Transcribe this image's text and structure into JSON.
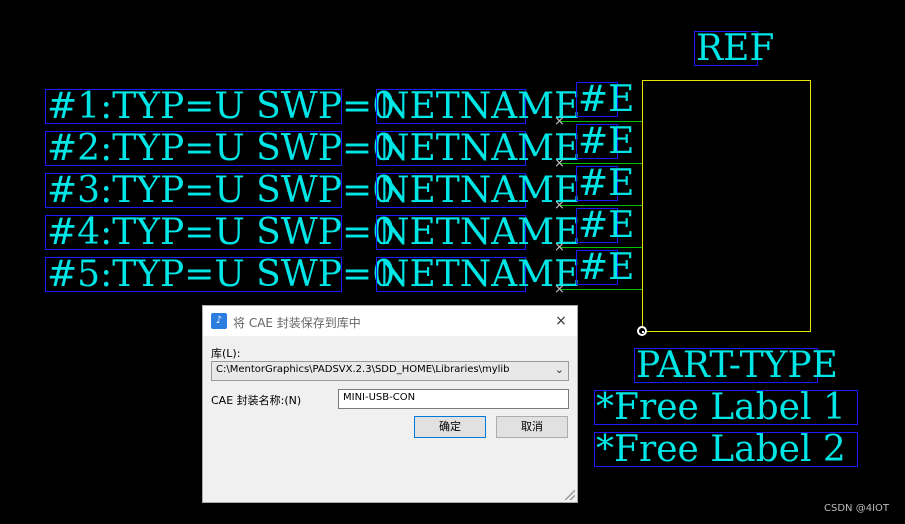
{
  "schematic": {
    "attributes": [
      {
        "pin": "#1:TYP=U SWP=0",
        "net": "NETNAME"
      },
      {
        "pin": "#2:TYP=U SWP=0",
        "net": "NETNAME"
      },
      {
        "pin": "#3:TYP=U SWP=0",
        "net": "NETNAME"
      },
      {
        "pin": "#4:TYP=U SWP=0",
        "net": "NETNAME"
      },
      {
        "pin": "#5:TYP=U SWP=0",
        "net": "NETNAME"
      }
    ],
    "pin_labels": [
      "#E",
      "#E",
      "#E",
      "#E",
      "#E"
    ],
    "ref": "REF",
    "part_type": "PART-TYPE",
    "free_labels": [
      "*Free Label 1",
      "*Free Label 2"
    ],
    "colors": {
      "text": "#00e5e5",
      "box": "#1a1aff",
      "pin": "#00c000",
      "outline": "#e5e500"
    }
  },
  "dialog": {
    "title": "将 CAE 封装保存到库中",
    "library_label": "库(L):",
    "library_value": "C:\\MentorGraphics\\PADSVX.2.3\\SDD_HOME\\Libraries\\mylib",
    "name_label": "CAE 封装名称:(N)",
    "name_value": "MINI-USB-CON",
    "ok_label": "确定",
    "cancel_label": "取消",
    "close_icon": "×"
  },
  "watermark": "CSDN @4IOT"
}
